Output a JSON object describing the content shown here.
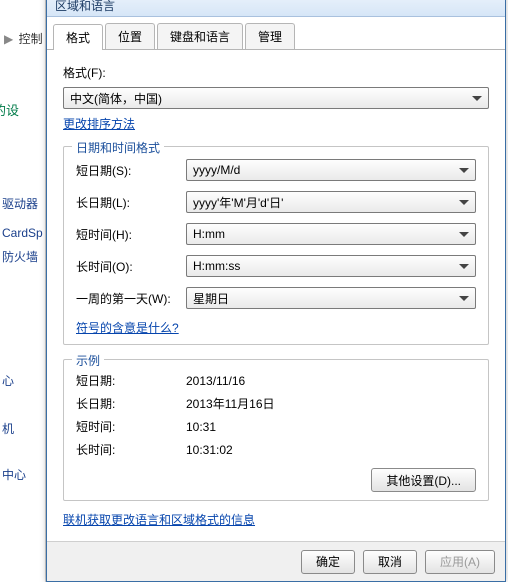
{
  "background": {
    "breadcrumb_item": "控制",
    "green_heading": "化的设",
    "side_links": [
      "驱动器",
      "CardSp",
      "防火墙",
      "心",
      "机",
      "中心"
    ]
  },
  "dialog": {
    "title": "区域和语言",
    "tabs": [
      {
        "label": "格式"
      },
      {
        "label": "位置"
      },
      {
        "label": "键盘和语言"
      },
      {
        "label": "管理"
      }
    ],
    "format_label": "格式(F):",
    "format_value": "中文(简体，中国)",
    "change_sort_link": "更改排序方法",
    "datetime_group": {
      "title": "日期和时间格式",
      "rows": [
        {
          "label": "短日期(S):",
          "value": "yyyy/M/d"
        },
        {
          "label": "长日期(L):",
          "value": "yyyy'年'M'月'd'日'"
        },
        {
          "label": "短时间(H):",
          "value": "H:mm"
        },
        {
          "label": "长时间(O):",
          "value": "H:mm:ss"
        },
        {
          "label": "一周的第一天(W):",
          "value": "星期日"
        }
      ],
      "symbol_meaning_link": "符号的含意是什么?"
    },
    "example_group": {
      "title": "示例",
      "rows": [
        {
          "label": "短日期:",
          "value": "2013/11/16"
        },
        {
          "label": "长日期:",
          "value": "2013年11月16日"
        },
        {
          "label": "短时间:",
          "value": "10:31"
        },
        {
          "label": "长时间:",
          "value": "10:31:02"
        }
      ]
    },
    "other_settings_button": "其他设置(D)...",
    "online_link": "联机获取更改语言和区域格式的信息",
    "footer": {
      "ok": "确定",
      "cancel": "取消",
      "apply": "应用(A)"
    }
  }
}
